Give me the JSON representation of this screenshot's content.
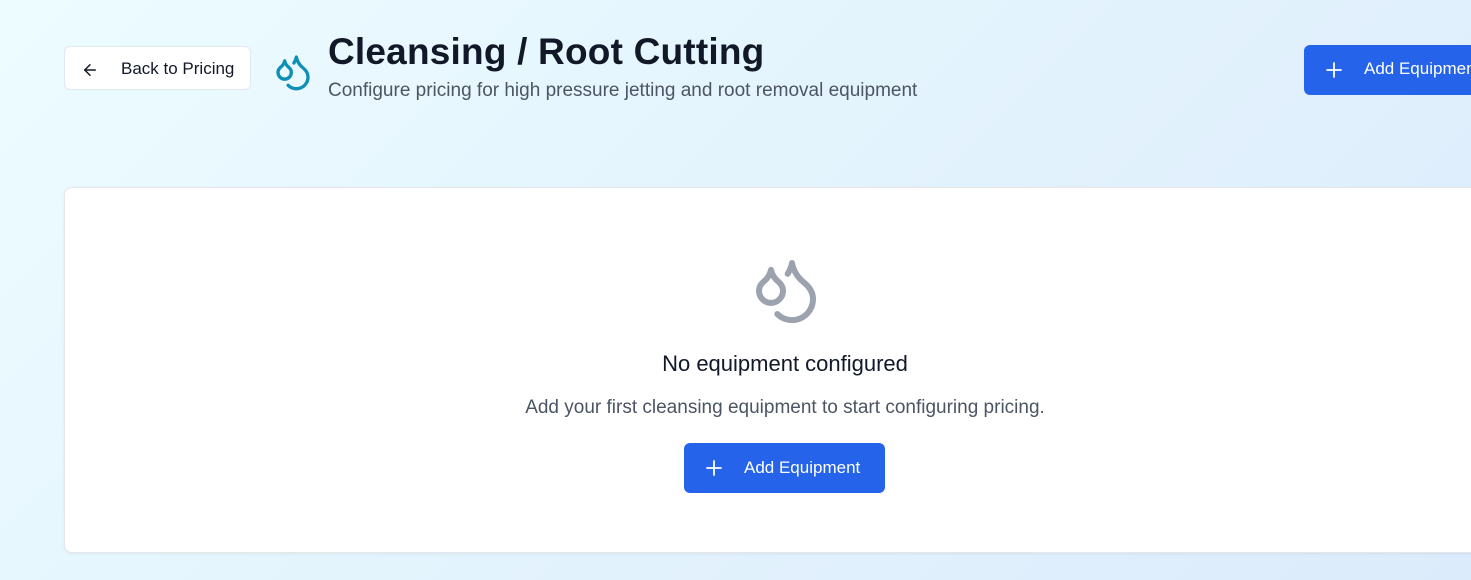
{
  "header": {
    "back_label": "Back to Pricing",
    "title": "Cleansing / Root Cutting",
    "subtitle": "Configure pricing for high pressure jetting and root removal equipment",
    "add_label": "Add Equipment",
    "icon": "droplets-icon"
  },
  "empty_state": {
    "icon": "droplets-icon",
    "title": "No equipment configured",
    "description": "Add your first cleansing equipment to start configuring pricing.",
    "add_label": "Add Equipment"
  },
  "colors": {
    "accent": "#2563eb",
    "header_icon": "#0e8fb5",
    "empty_icon": "#9ca3af"
  }
}
